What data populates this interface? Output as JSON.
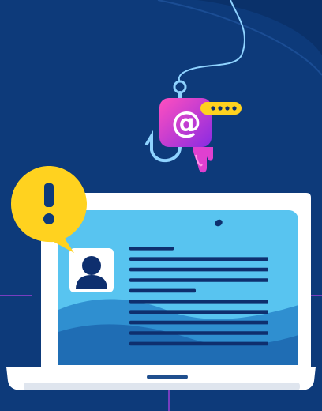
{
  "illustration": {
    "subject": "phishing-email-hook-over-laptop",
    "icons": {
      "hook": "fishing-hook-icon",
      "email": "at-sign-email-icon",
      "password": "password-dots-icon",
      "warning": "exclamation-warning-icon",
      "profile": "user-profile-icon"
    },
    "email_glyph": "@",
    "warning_glyph": "!",
    "password_dot_count": 4,
    "content_line_count": 10
  },
  "colors": {
    "background": "#0d3a7a",
    "background_dark": "#0a2f66",
    "grid_lines": "#9b3fd6",
    "hook_line": "#8fd3ff",
    "email_gradient_start": "#ff4fbf",
    "email_gradient_end": "#8a2be2",
    "drip": "#e040d0",
    "password_field": "#ffd21f",
    "warning_badge": "#ffd21f",
    "warning_mark": "#0d3a7a",
    "laptop_body": "#ffffff",
    "laptop_base": "#dfe5ee",
    "screen_light": "#58c4f0",
    "screen_mid": "#2f8fd0",
    "screen_dark": "#1f6db4",
    "text_lines": "#0e2f6e",
    "profile_card": "#ffffff",
    "profile_figure": "#0e2f6e"
  }
}
